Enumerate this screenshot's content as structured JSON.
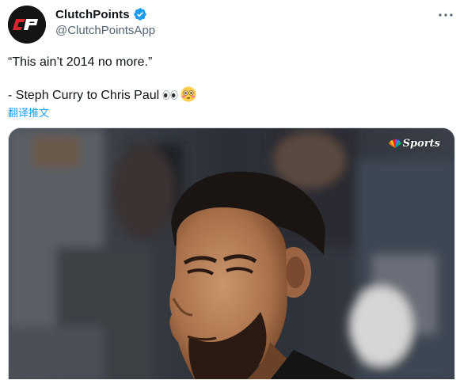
{
  "author": {
    "display_name": "ClutchPoints",
    "handle": "@ClutchPointsApp",
    "avatar_icon": "clutchpoints-logo-icon",
    "verified_icon": "verified-badge-icon",
    "verified_color": "#1d9bf0",
    "logo_color": "#d7262e"
  },
  "header": {
    "more_icon": "more-options-icon"
  },
  "tweet": {
    "line1": "“This ain’t 2014 no more.”",
    "line2": "- Steph Curry to Chris Paul",
    "emoji_1": "eyes-emoji-icon",
    "emoji_2": "flushed-face-emoji-icon",
    "translate_label": "翻译推文",
    "link_color": "#1d9bf0"
  },
  "media": {
    "type": "video",
    "watermark_text": "Sports",
    "watermark_icon": "nbc-peacock-icon"
  }
}
